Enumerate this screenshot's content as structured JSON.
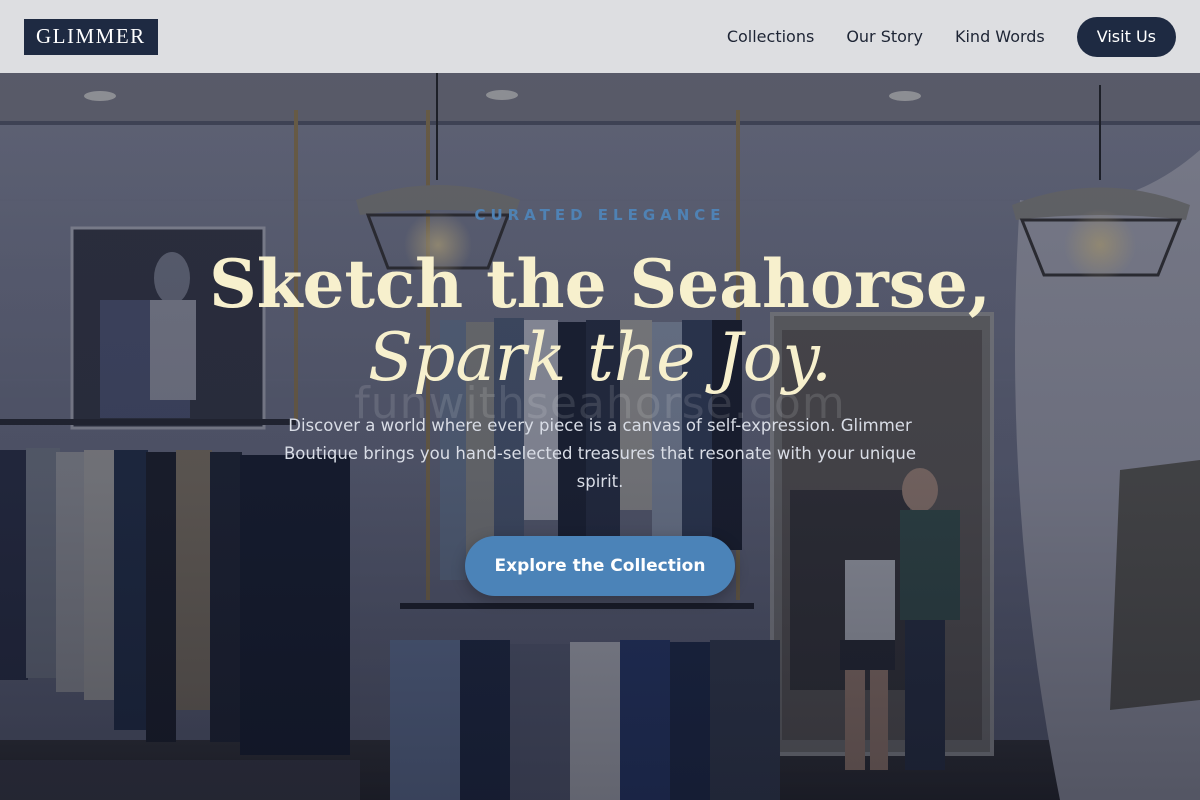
{
  "brand": {
    "logo_text": "GLIMMER"
  },
  "nav": {
    "links": [
      "Collections",
      "Our Story",
      "Kind Words"
    ],
    "cta_label": "Visit Us"
  },
  "hero": {
    "eyebrow": "CURATED ELEGANCE",
    "headline_line1": "Sketch the Seahorse,",
    "headline_line2": "Spark the Joy.",
    "watermark": "funwithseahorse.com",
    "subtitle": "Discover a world where every piece is a canvas of self-expression. Glimmer Boutique brings you hand-selected treasures that resonate with your unique spirit.",
    "cta_label": "Explore the Collection",
    "background": "boutique-interior-photo"
  },
  "colors": {
    "navy": "#1e2a42",
    "accent_blue": "#4b83b8",
    "headline_cream": "#f7f0cd",
    "header_bg": "#e2e3e5"
  }
}
